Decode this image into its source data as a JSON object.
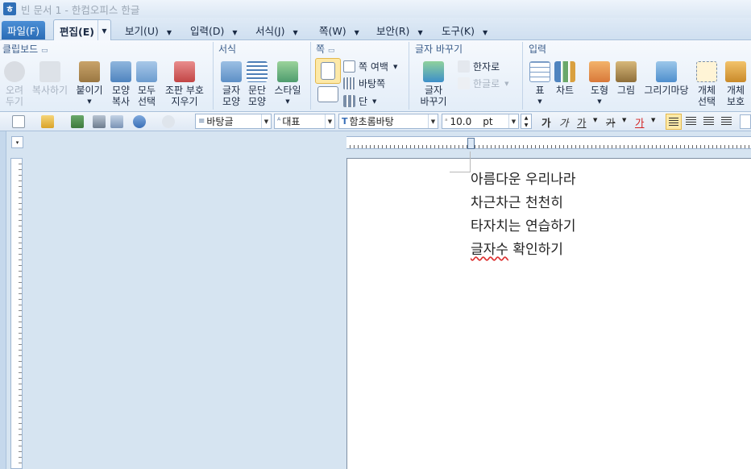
{
  "window": {
    "title": "빈 문서 1 - 한컴오피스 한글"
  },
  "menu": {
    "file": "파일(F)",
    "edit": "편집(E)",
    "items": [
      "보기(U)",
      "입력(D)",
      "서식(J)",
      "쪽(W)",
      "보안(R)",
      "도구(K)"
    ]
  },
  "ribbon": {
    "clipboard": {
      "title": "클립보드",
      "cut": "오려\n두기",
      "copy": "복사하기",
      "paste": "붙이기",
      "format_copy": "모양\n복사",
      "select_all": "모두\n선택",
      "clear_code": "조판 부호\n지우기"
    },
    "format": {
      "title": "서식",
      "char_shape": "글자\n모양",
      "para_shape": "문단\n모양",
      "style": "스타일"
    },
    "page": {
      "title": "쪽",
      "margin": "쪽 여백",
      "background": "바탕쪽",
      "columns": "단"
    },
    "convert": {
      "title": "글자 바꾸기",
      "change": "글자\n바꾸기",
      "to_hanja": "한자로",
      "to_hangul": "한글로"
    },
    "insert": {
      "title": "입력",
      "table": "표",
      "chart": "차트",
      "shape": "도형",
      "picture": "그림",
      "drawing_market": "그리기마당",
      "select_object": "개체\n선택",
      "protect_object": "개체\n보호"
    }
  },
  "toolbar": {
    "style_combo": "바탕글",
    "lang_combo": "대표",
    "font_combo": "함초롬바탕",
    "size_value": "10.0",
    "size_unit": "pt",
    "bold": "가",
    "italic": "가",
    "underline": "가",
    "strike": "가",
    "color": "가"
  },
  "document": {
    "lines": [
      "아름다운 우리나라",
      "차근차근 천천히",
      "타자치는 연습하기"
    ],
    "last_line_marked": "글자수",
    "last_line_rest": " 확인하기"
  }
}
